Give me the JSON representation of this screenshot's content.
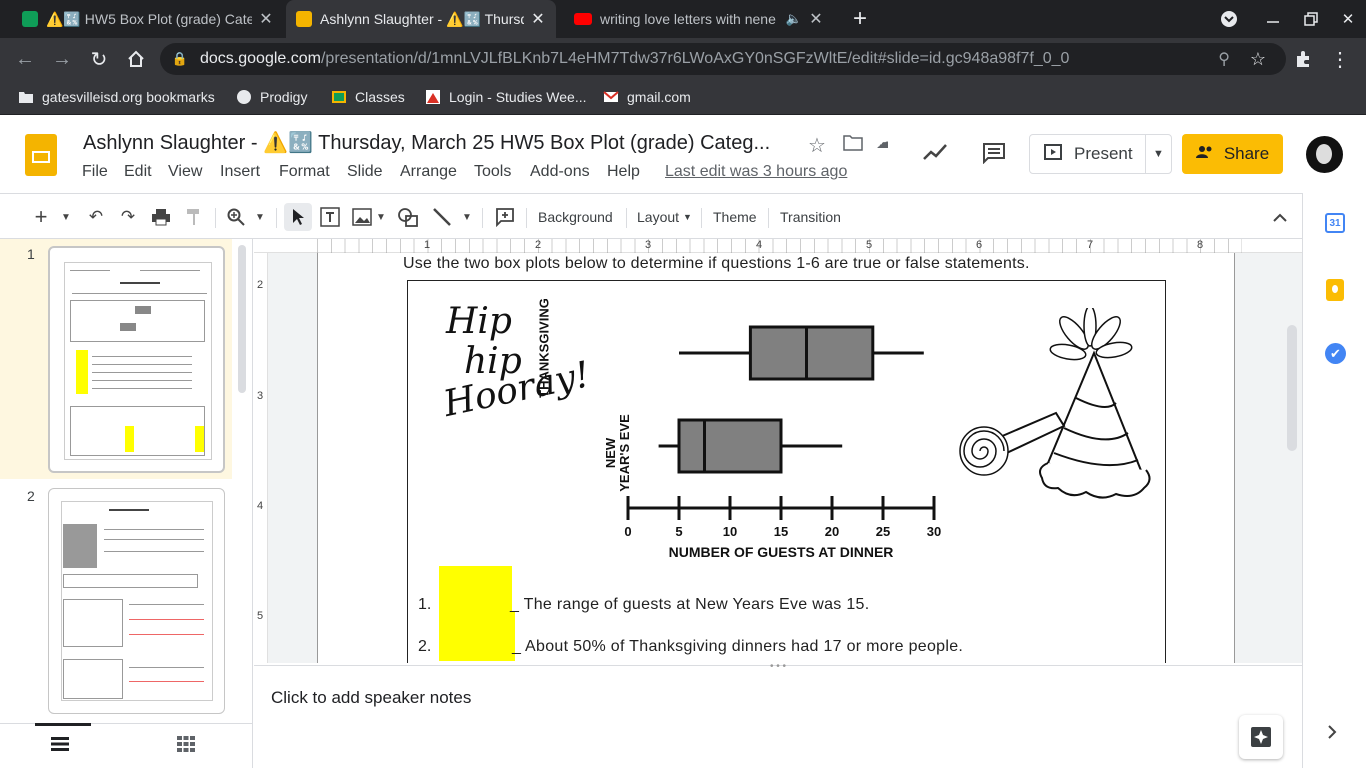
{
  "browser": {
    "tabs": [
      {
        "title": "⚠️🔣 HW5 Box Plot (grade) Cate",
        "favicon_color": "#0f9d58"
      },
      {
        "title": "Ashlynn Slaughter - ⚠️🔣 Thursd",
        "favicon_color": "#f4b400"
      },
      {
        "title": "writing love letters with nene",
        "favicon_color": "#ff0000"
      }
    ],
    "new_tab": "+",
    "url_host": "docs.google.com",
    "url_path": "/presentation/d/1mnLVJLfBLKnb7L4eHM7Tdw37r6LWoAxGY0nSGFzWltE/edit#slide=id.gc948a98f7f_0_0",
    "bookmarks": [
      {
        "label": "gatesvilleisd.org bookmarks"
      },
      {
        "label": "Prodigy"
      },
      {
        "label": "Classes"
      },
      {
        "label": "Login - Studies Wee..."
      },
      {
        "label": "gmail.com"
      }
    ]
  },
  "doc": {
    "title": "Ashlynn Slaughter - ⚠️🔣 Thursday, March 25 HW5 Box Plot (grade) Categ...",
    "menus": [
      "File",
      "Edit",
      "View",
      "Insert",
      "Format",
      "Slide",
      "Arrange",
      "Tools",
      "Add-ons",
      "Help"
    ],
    "last_edit": "Last edit was 3 hours ago",
    "present_label": "Present",
    "share_label": "Share",
    "toolbar": {
      "background": "Background",
      "layout": "Layout",
      "theme": "Theme",
      "transition": "Transition"
    },
    "ruler_numbers": [
      "1",
      "2",
      "3",
      "4",
      "5",
      "6",
      "7",
      "8"
    ],
    "vruler_numbers": [
      "2",
      "3",
      "4",
      "5"
    ],
    "slide_numbers": [
      "1",
      "2"
    ],
    "notes_placeholder": "Click to add speaker notes"
  },
  "slide": {
    "instructions": "Use the two box plots below to determine if questions 1-6 are true or false statements.",
    "hip_lines": [
      "Hip",
      "hip",
      "Hooray!"
    ],
    "label_thanksgiving": "THANKSGIVING",
    "label_nye_1": "NEW",
    "label_nye_2": "YEAR'S EVE",
    "q1_num": "1.",
    "q1_text": "_ The range of guests at New Years Eve was 15.",
    "q2_num": "2.",
    "q2_text": "_ About 50% of Thanksgiving dinners had 17 or more people."
  },
  "chart_data": {
    "type": "boxplot",
    "xlabel": "NUMBER OF GUESTS AT DINNER",
    "xlim": [
      0,
      30
    ],
    "ticks": [
      0,
      5,
      10,
      15,
      20,
      25,
      30
    ],
    "tick_labels": [
      "0",
      "5",
      "10",
      "15",
      "20",
      "25",
      "30"
    ],
    "series": [
      {
        "name": "THANKSGIVING",
        "min": 5,
        "q1": 12,
        "median": 17.5,
        "q3": 24,
        "max": 29,
        "fill": "#808080"
      },
      {
        "name": "NEW YEAR'S EVE",
        "min": 3,
        "q1": 5,
        "median": 7.5,
        "q3": 15,
        "max": 21,
        "fill": "#808080"
      }
    ]
  }
}
